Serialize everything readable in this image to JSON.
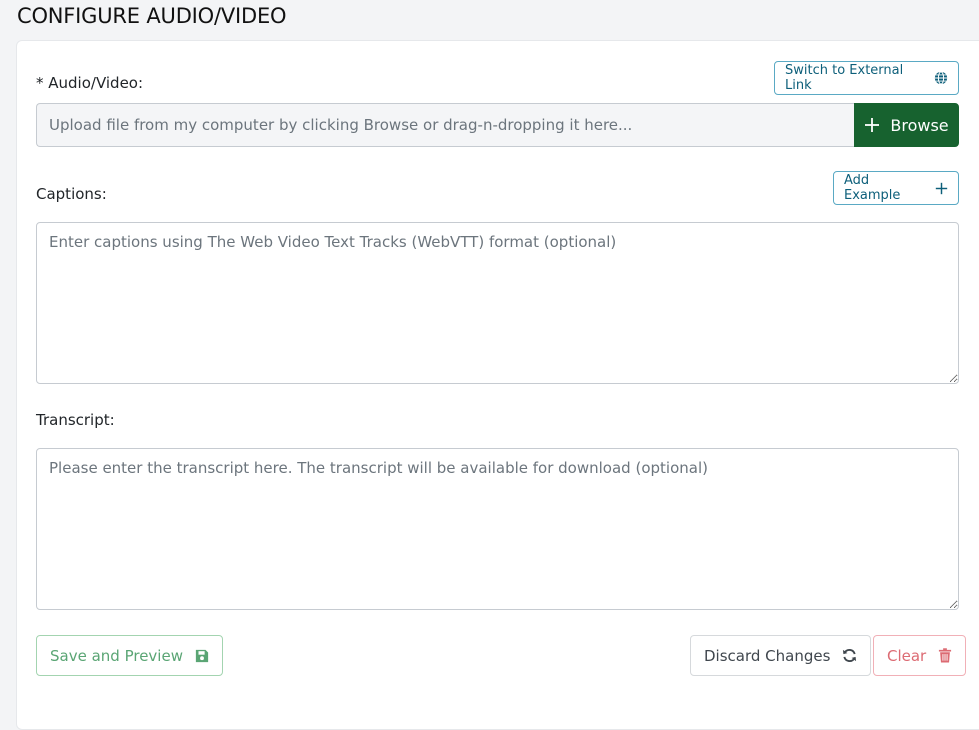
{
  "page": {
    "title": "CONFIGURE AUDIO/VIDEO"
  },
  "audio_video": {
    "label": "* Audio/Video:",
    "switch_label": "Switch to External Link",
    "switch_icon": "globe-icon",
    "placeholder": "Upload file from my computer by clicking Browse or drag-n-dropping it here...",
    "browse_label": "Browse",
    "browse_icon": "plus-icon"
  },
  "captions": {
    "label": "Captions:",
    "add_example_label": "Add Example",
    "add_example_icon": "plus-icon",
    "placeholder": "Enter captions using The Web Video Text Tracks (WebVTT) format (optional)"
  },
  "transcript": {
    "label": "Transcript:",
    "placeholder": "Please enter the transcript here. The transcript will be available for download (optional)"
  },
  "actions": {
    "save_label": "Save and Preview",
    "save_icon": "save-icon",
    "discard_label": "Discard Changes",
    "discard_icon": "refresh-icon",
    "clear_label": "Clear",
    "clear_icon": "trash-icon"
  },
  "colors": {
    "browse_bg": "#17622f",
    "info_outline": "#5aa9c4",
    "success_outline": "#a3d4b0",
    "danger_outline": "#f1b0b7"
  }
}
